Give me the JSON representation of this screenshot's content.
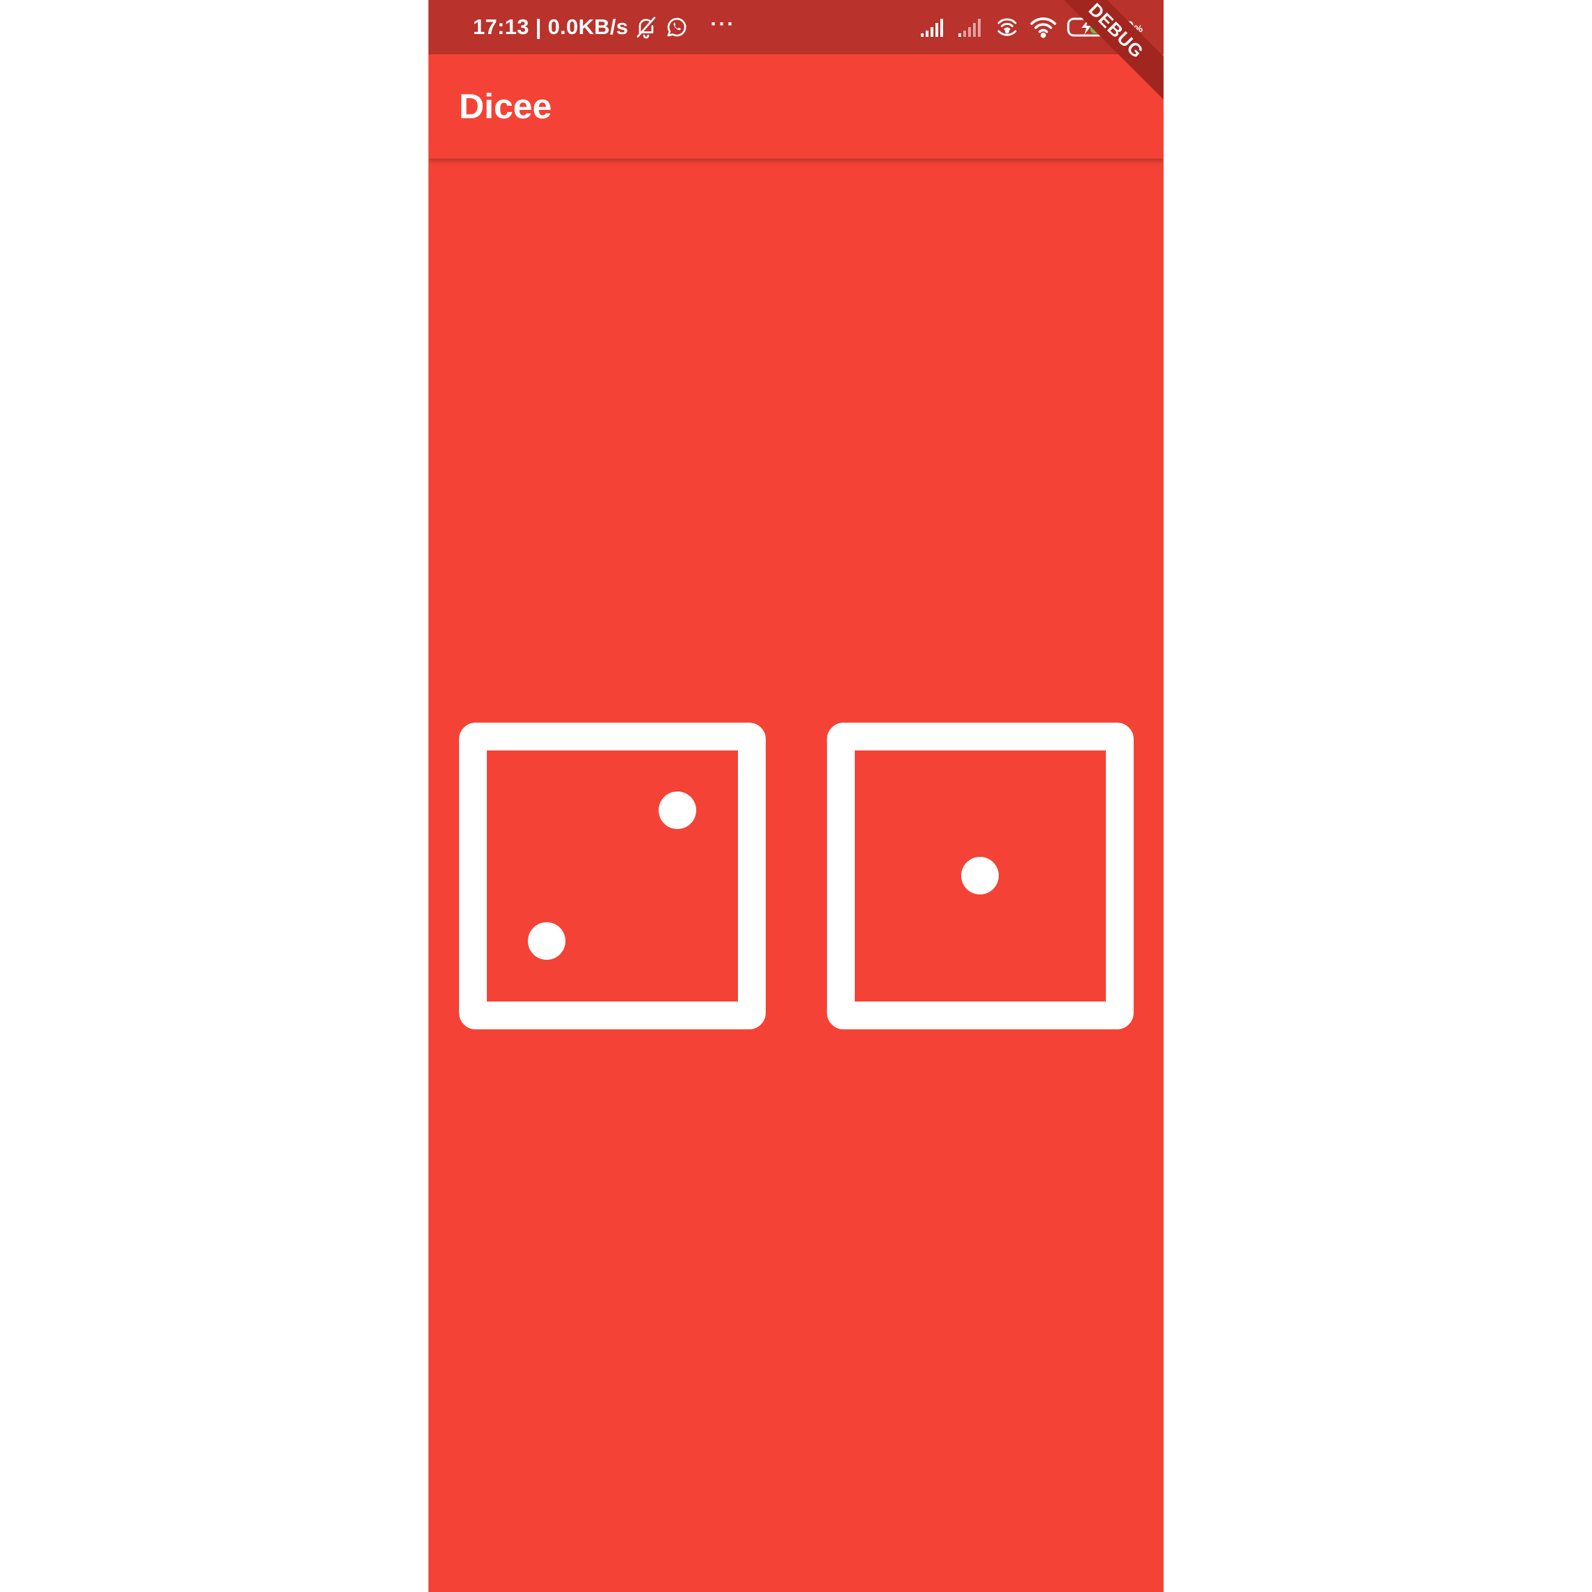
{
  "status_bar": {
    "time_and_speed": "17:13 | 0.0KB/s",
    "more_indicator": "···",
    "battery_percent": "60",
    "battery_percent_unit": "%",
    "icons": [
      "bell-off-icon",
      "whatsapp-icon",
      "signal-icon",
      "signal-icon",
      "hotspot-icon",
      "wifi-icon",
      "battery-charging-icon"
    ]
  },
  "app_bar": {
    "title": "Dicee"
  },
  "debug_banner": {
    "label": "DEBUG"
  },
  "dice": [
    {
      "name": "left-dice",
      "value": 2
    },
    {
      "name": "right-dice",
      "value": 1
    }
  ],
  "colors": {
    "background": "#f44336",
    "status_bar": "#b9322b",
    "dice_face": "#ffffff"
  }
}
